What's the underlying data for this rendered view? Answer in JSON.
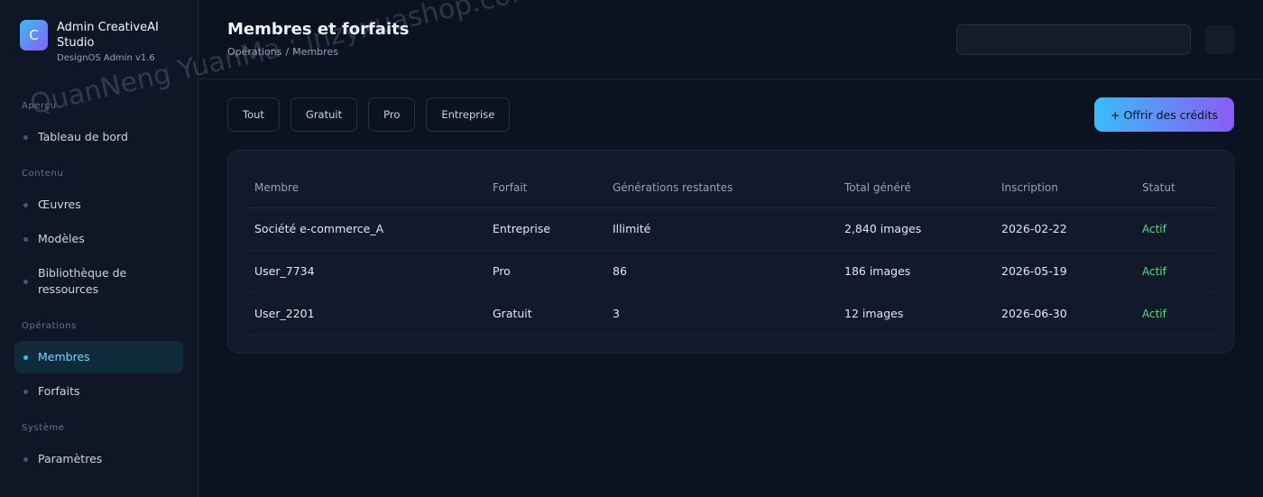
{
  "brand": {
    "logo_letter": "C",
    "name": "Admin CreativeAI Studio",
    "version": "DesignOS Admin v1.6"
  },
  "sidebar": {
    "sections": [
      {
        "label": "Aperçu",
        "items": [
          {
            "label": "Tableau de bord"
          }
        ]
      },
      {
        "label": "Contenu",
        "items": [
          {
            "label": "Œuvres"
          },
          {
            "label": "Modèles"
          },
          {
            "label": "Bibliothèque de ressources"
          }
        ]
      },
      {
        "label": "Opérations",
        "items": [
          {
            "label": "Membres",
            "active": true
          },
          {
            "label": "Forfaits"
          }
        ]
      },
      {
        "label": "Système",
        "items": [
          {
            "label": "Paramètres"
          }
        ]
      }
    ]
  },
  "header": {
    "title": "Membres et forfaits",
    "breadcrumb": [
      "Opérations",
      "/",
      "Membres"
    ]
  },
  "filters": [
    "Tout",
    "Gratuit",
    "Pro",
    "Entreprise"
  ],
  "offer_button": "+ Offrir des crédits",
  "table": {
    "columns": [
      "Membre",
      "Forfait",
      "Générations restantes",
      "Total généré",
      "Inscription",
      "Statut"
    ],
    "rows": [
      [
        "Société e-commerce_A",
        "Entreprise",
        "Illimité",
        "2,840 images",
        "2026-02-22",
        "Actif"
      ],
      [
        "User_7734",
        "Pro",
        "86",
        "186 images",
        "2026-05-19",
        "Actif"
      ],
      [
        "User_2201",
        "Gratuit",
        "3",
        "12 images",
        "2026-06-30",
        "Actif"
      ]
    ]
  },
  "watermark": "QuanNeng YuanMa : inzyxuashop.com",
  "colors": {
    "accent": "#38bdf8",
    "accent_secondary": "#8b5cf6",
    "status_active": "#4ade80",
    "background": "#0b1220"
  }
}
